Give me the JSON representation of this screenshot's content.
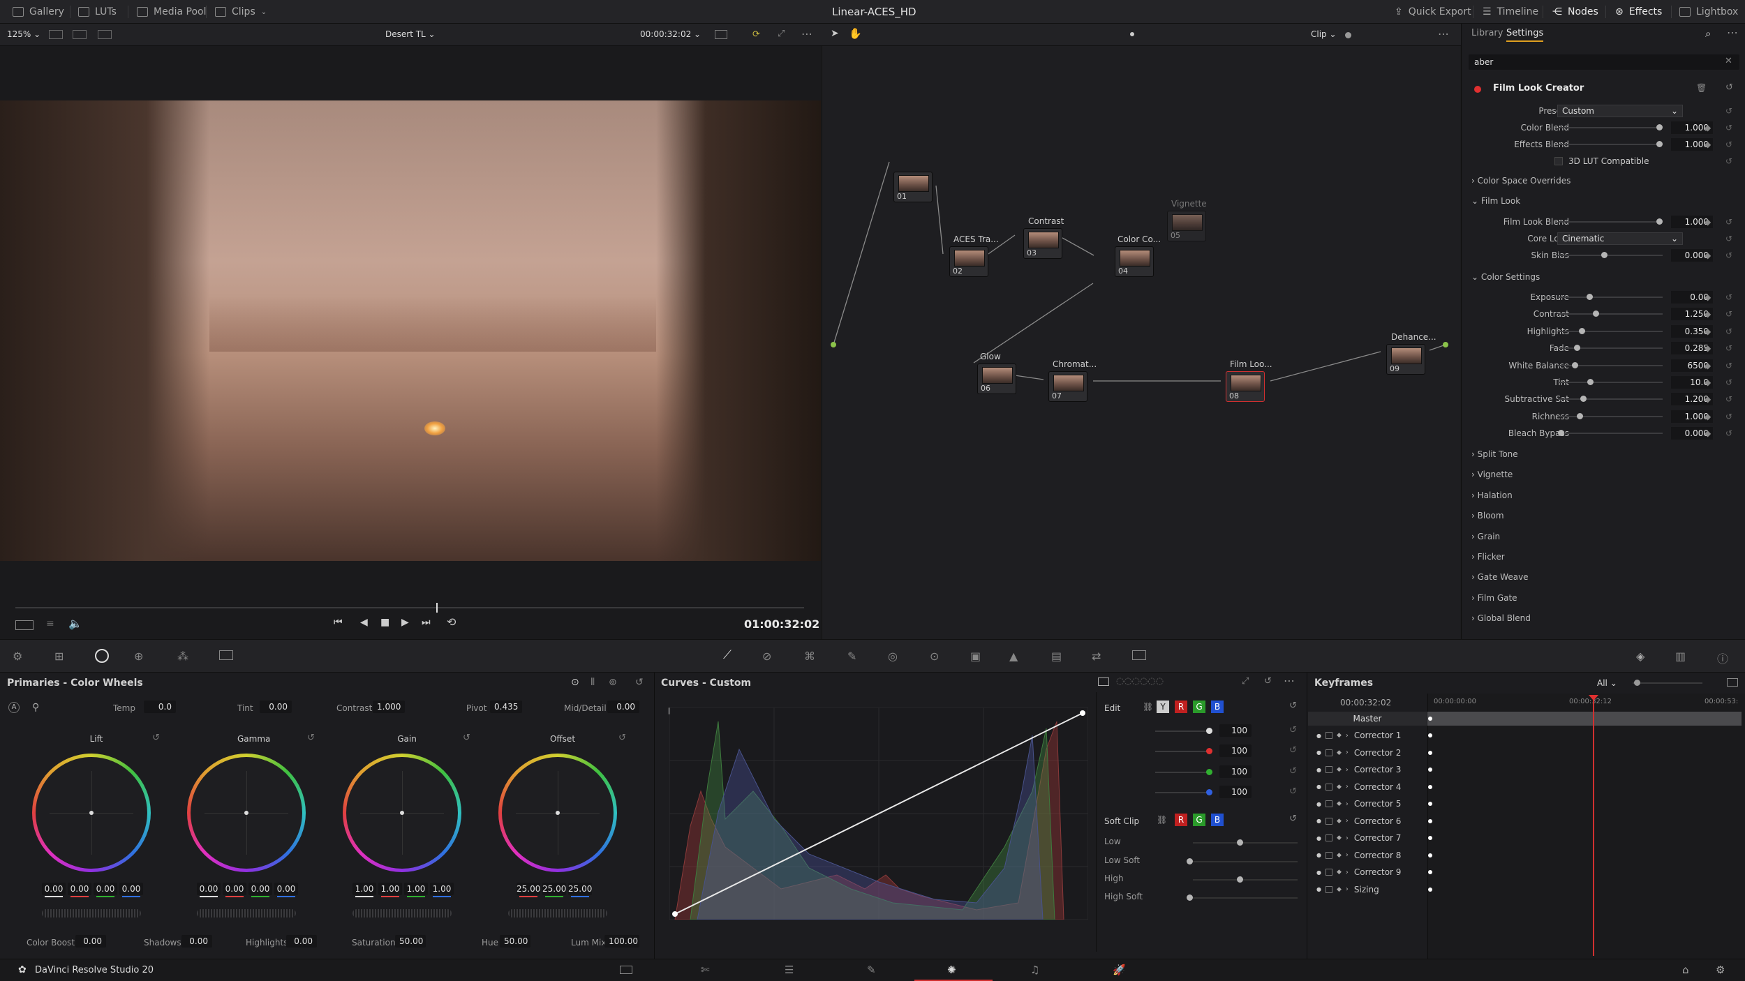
{
  "topbar": {
    "gallery": "Gallery",
    "luts": "LUTs",
    "media_pool": "Media Pool",
    "clips": "Clips",
    "project": "Linear-ACES_HD",
    "quick_export": "Quick Export",
    "timeline": "Timeline",
    "nodes": "Nodes",
    "effects": "Effects",
    "lightbox": "Lightbox"
  },
  "viewer": {
    "zoom": "125%",
    "timeline_name": "Desert TL",
    "timecode": "00:00:32:02",
    "clip_mode": "Clip",
    "playhead_timecode": "01:00:32:02"
  },
  "nodes": [
    {
      "num": "01"
    },
    {
      "num": "02",
      "label": "ACES Tra..."
    },
    {
      "num": "03",
      "label": "Contrast"
    },
    {
      "num": "04",
      "label": "Color Co..."
    },
    {
      "num": "05",
      "label": "Vignette"
    },
    {
      "num": "06",
      "label": "Glow"
    },
    {
      "num": "07",
      "label": "Chromat..."
    },
    {
      "num": "08",
      "label": "Film Loo..."
    },
    {
      "num": "09",
      "label": "Dehance..."
    }
  ],
  "effects": {
    "tab_library": "Library",
    "tab_settings": "Settings",
    "search": "aber",
    "title": "Film Look Creator",
    "presets_label": "Presets",
    "presets_value": "Custom",
    "color_blend_label": "Color Blend",
    "color_blend": "1.000",
    "effects_blend_label": "Effects Blend",
    "effects_blend": "1.000",
    "lut_compat": "3D LUT Compatible",
    "sec_cso": "Color Space Overrides",
    "sec_filmlook": "Film Look",
    "film_look_blend_label": "Film Look Blend",
    "film_look_blend": "1.000",
    "core_look_label": "Core Look",
    "core_look_value": "Cinematic",
    "skin_bias_label": "Skin Bias",
    "skin_bias": "0.000",
    "sec_color_settings": "Color Settings",
    "color_settings": [
      {
        "label": "Exposure",
        "value": "0.00",
        "pos": 0.27
      },
      {
        "label": "Contrast",
        "value": "1.250",
        "pos": 0.33
      },
      {
        "label": "Highlights",
        "value": "0.350",
        "pos": 0.2
      },
      {
        "label": "Fade",
        "value": "0.285",
        "pos": 0.15
      },
      {
        "label": "White Balance",
        "value": "6500",
        "pos": 0.13
      },
      {
        "label": "Tint",
        "value": "10.0",
        "pos": 0.28
      },
      {
        "label": "Subtractive Sat",
        "value": "1.200",
        "pos": 0.21
      },
      {
        "label": "Richness",
        "value": "1.000",
        "pos": 0.18
      },
      {
        "label": "Bleach Bypass",
        "value": "0.000",
        "pos": 0.0
      }
    ],
    "more_sections": [
      "Split Tone",
      "Vignette",
      "Halation",
      "Bloom",
      "Grain",
      "Flicker",
      "Gate Weave",
      "Film Gate",
      "Global Blend"
    ]
  },
  "primaries": {
    "title": "Primaries - Color Wheels",
    "temp_label": "Temp",
    "temp": "0.0",
    "tint_label": "Tint",
    "tint": "0.00",
    "contrast_label": "Contrast",
    "contrast": "1.000",
    "pivot_label": "Pivot",
    "pivot": "0.435",
    "middetail_label": "Mid/Detail",
    "middetail": "0.00",
    "wheels": [
      {
        "name": "Lift",
        "values": [
          "0.00",
          "0.00",
          "0.00",
          "0.00"
        ]
      },
      {
        "name": "Gamma",
        "values": [
          "0.00",
          "0.00",
          "0.00",
          "0.00"
        ]
      },
      {
        "name": "Gain",
        "values": [
          "1.00",
          "1.00",
          "1.00",
          "1.00"
        ]
      },
      {
        "name": "Offset",
        "values": [
          "25.00",
          "25.00",
          "25.00"
        ]
      }
    ],
    "color_boost_label": "Color Boost",
    "color_boost": "0.00",
    "shadows_label": "Shadows",
    "shadows": "0.00",
    "highlights_label": "Highlights",
    "highlights": "0.00",
    "saturation_label": "Saturation",
    "saturation": "50.00",
    "hue_label": "Hue",
    "hue": "50.00",
    "lummix_label": "Lum Mix",
    "lummix": "100.00"
  },
  "curves": {
    "title": "Curves - Custom",
    "edit_label": "Edit",
    "y": "Y",
    "r": "R",
    "g": "G",
    "b": "B",
    "values": [
      "100",
      "100",
      "100",
      "100"
    ],
    "soft_clip_label": "Soft Clip",
    "low": "Low",
    "low_soft": "Low Soft",
    "high": "High",
    "high_soft": "High Soft"
  },
  "keyframes": {
    "title": "Keyframes",
    "filter": "All",
    "timecode": "00:00:32:02",
    "ruler_start": "00:00:00:00",
    "ruler_mid": "00:00:32:12",
    "ruler_end": "00:00:53:",
    "master": "Master",
    "rows": [
      "Corrector 1",
      "Corrector 2",
      "Corrector 3",
      "Corrector 4",
      "Corrector 5",
      "Corrector 6",
      "Corrector 7",
      "Corrector 8",
      "Corrector 9",
      "Sizing"
    ]
  },
  "footer": {
    "app": "DaVinci Resolve Studio 20"
  }
}
